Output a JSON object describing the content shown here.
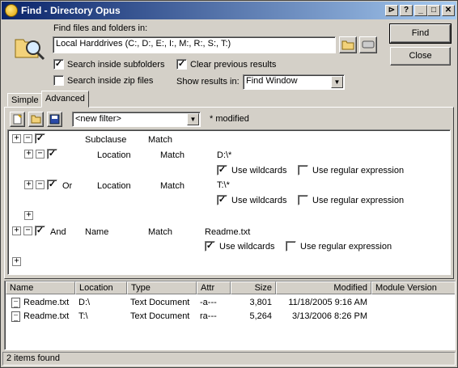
{
  "window": {
    "title": "Find - Directory Opus",
    "controls": [
      "⊳",
      "?",
      "_",
      "□",
      "✕"
    ]
  },
  "search": {
    "find_label": "Find files and folders in:",
    "location_value": "Local Harddrives (C:, D:, E:, I:, M:, R:, S:, T:)",
    "inside_subfolders_label": "Search inside subfolders",
    "inside_subfolders_checked": true,
    "clear_previous_label": "Clear previous results",
    "clear_previous_checked": true,
    "inside_zip_label": "Search inside zip files",
    "inside_zip_checked": false,
    "show_results_label": "Show results in:",
    "show_results_value": "Find Window"
  },
  "buttons": {
    "find": "Find",
    "close": "Close"
  },
  "tabs": [
    {
      "label": "Simple",
      "active": false
    },
    {
      "label": "Advanced",
      "active": true
    }
  ],
  "filter": {
    "select_value": "<new filter>",
    "modified_label": "* modified"
  },
  "clauses": {
    "top": {
      "kind": "Subclause",
      "mode": "Match"
    },
    "loc1": {
      "field": "Location",
      "mode": "Match",
      "value": "D:\\*",
      "wildcards": "Use wildcards",
      "regex": "Use regular expression"
    },
    "loc2": {
      "op": "Or",
      "field": "Location",
      "mode": "Match",
      "value": "T:\\*",
      "wildcards": "Use wildcards",
      "regex": "Use regular expression"
    },
    "name": {
      "op": "And",
      "field": "Name",
      "mode": "Match",
      "value": "Readme.txt",
      "wildcards": "Use wildcards",
      "regex": "Use regular expression"
    }
  },
  "results": {
    "columns": [
      "Name",
      "Location",
      "Type",
      "Attr",
      "Size",
      "Modified",
      "Module Version"
    ],
    "rows": [
      {
        "name": "Readme.txt",
        "location": "D:\\",
        "type": "Text Document",
        "attr": "-a---",
        "size": "3,801",
        "modified": "11/18/2005 9:16 AM",
        "version": ""
      },
      {
        "name": "Readme.txt",
        "location": "T:\\",
        "type": "Text Document",
        "attr": "ra---",
        "size": "5,264",
        "modified": "3/13/2006 8:26 PM",
        "version": ""
      }
    ]
  },
  "status": {
    "text": "2 items found"
  }
}
